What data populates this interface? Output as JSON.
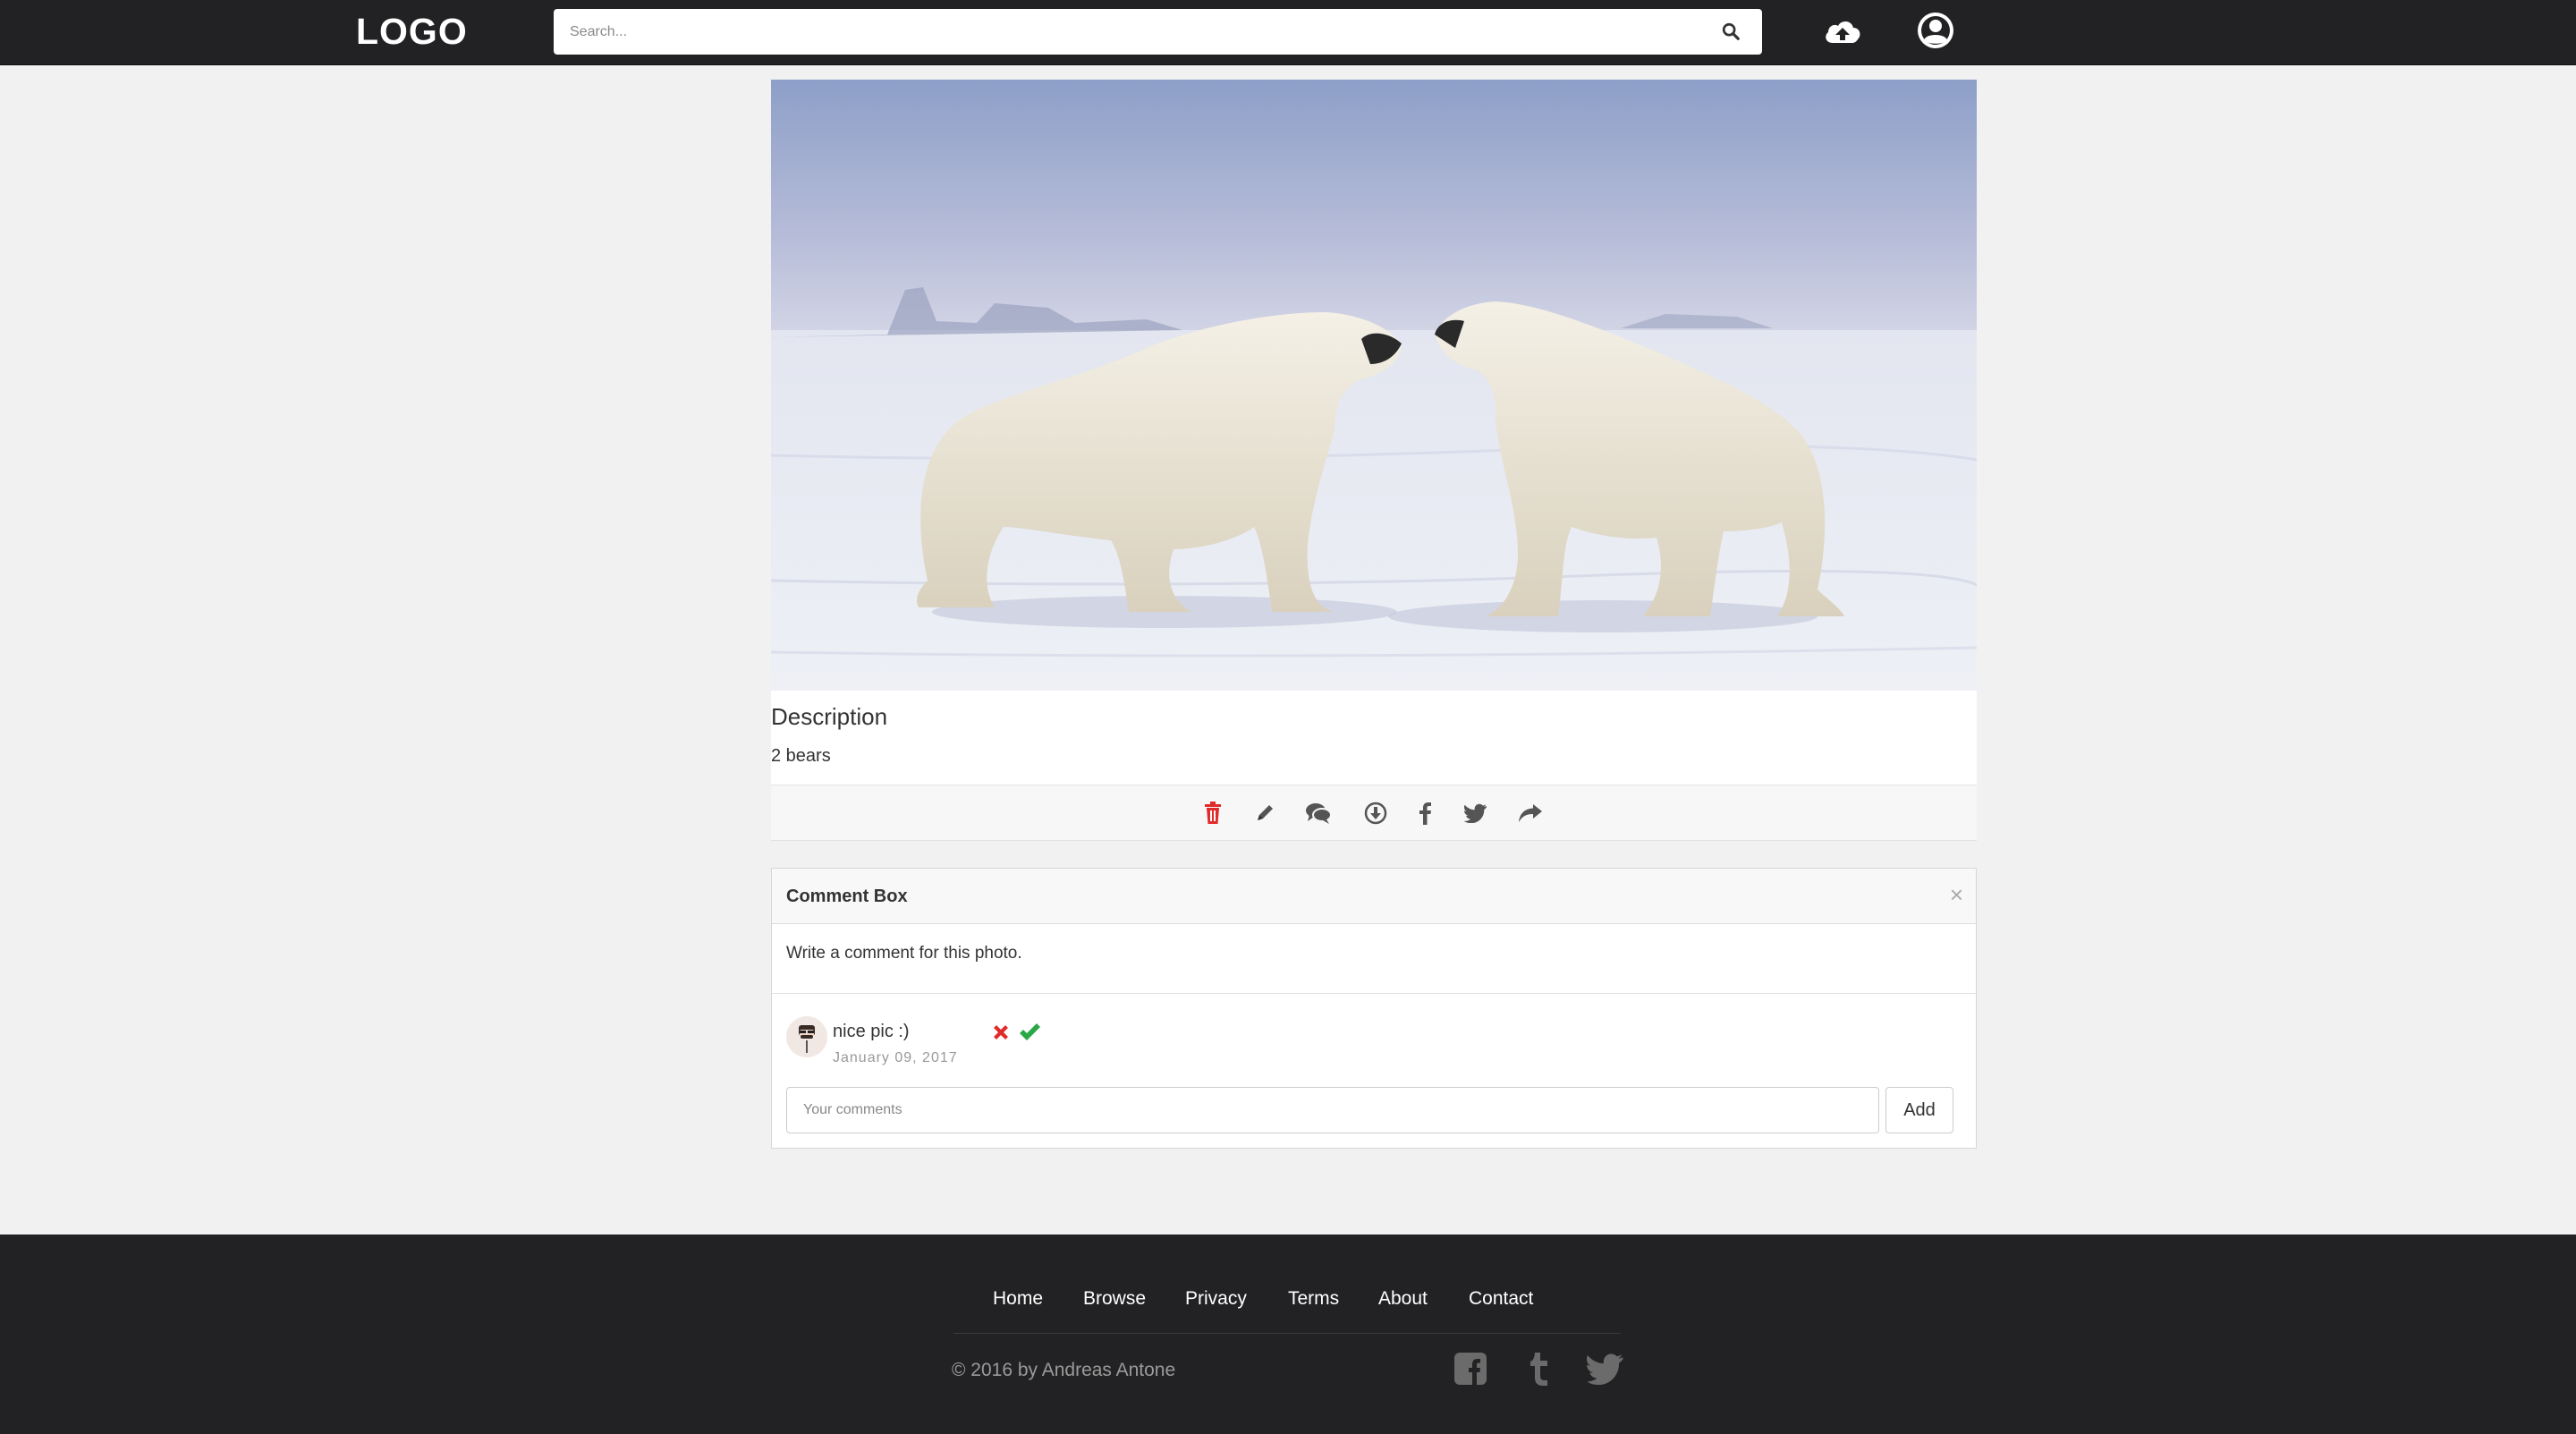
{
  "header": {
    "logo": "LOGO",
    "search_placeholder": "Search...",
    "icons": [
      "search-icon",
      "cloud-upload-icon",
      "user-circle-icon"
    ]
  },
  "photo": {
    "alt": "Two polar bears touching noses on snow",
    "description_title": "Description",
    "description_text": "2 bears"
  },
  "actions": [
    "trash-icon",
    "pencil-icon",
    "comments-icon",
    "download-icon",
    "facebook-icon",
    "twitter-icon",
    "share-icon"
  ],
  "comment_box": {
    "title": "Comment Box",
    "close": "×",
    "intro": "Write a comment for this photo.",
    "comments": [
      {
        "text": "nice pic :)",
        "date": "January 09, 2017"
      }
    ],
    "input_placeholder": "Your comments",
    "add_label": "Add"
  },
  "footer": {
    "links": [
      "Home",
      "Browse",
      "Privacy",
      "Terms",
      "About",
      "Contact"
    ],
    "copyright": "© 2016 by Andreas Antone",
    "social": [
      "facebook-square-icon",
      "tumblr-icon",
      "twitter-icon"
    ]
  },
  "colors": {
    "navbar": "#222224",
    "background": "#f1f1f1",
    "delete": "#e02b2b",
    "approve": "#2aa845",
    "icon": "#555555"
  }
}
